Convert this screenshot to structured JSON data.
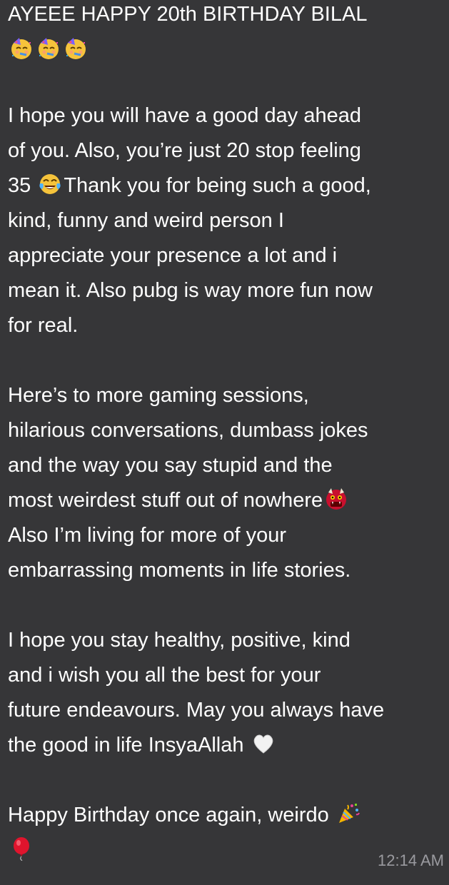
{
  "message": {
    "line_01": "AYEEE HAPPY 20th BIRTHDAY BILAL",
    "line_03": "I hope you will have a good day ahead",
    "line_04": "of you. Also, you’re just 20 stop feeling",
    "line_05a": "35",
    "line_05b": "Thank you for being such a good,",
    "line_06": "kind, funny and weird person I",
    "line_07": "appreciate your presence a lot and i",
    "line_08": "mean it. Also pubg is way more fun now",
    "line_09": "for real.",
    "line_10": "Here’s to more gaming sessions,",
    "line_11": "hilarious conversations, dumbass jokes",
    "line_12": "and the way you say stupid and the",
    "line_13": "most weirdest stuff out of nowhere",
    "line_14": "Also I’m living for more of your",
    "line_15": "embarrassing moments in life stories.",
    "line_16": "I hope you stay healthy, positive, kind",
    "line_17": "and i wish you all the best for your",
    "line_18": "future endeavours. May you always have",
    "line_19": "the good in life InsyaAllah",
    "line_20": "Happy Birthday once again, weirdo",
    "timestamp": "12:14 AM"
  },
  "emojis": {
    "line_02": [
      "partying-face",
      "partying-face",
      "partying-face"
    ],
    "line_05": "face-with-tears-of-joy",
    "line_13": "ogre",
    "line_19": "white-heart",
    "line_20": "party-popper",
    "line_21": "balloon"
  },
  "colors": {
    "bubble_background": "#363638",
    "text": "#ffffff",
    "timestamp": "#9a9a9f"
  }
}
